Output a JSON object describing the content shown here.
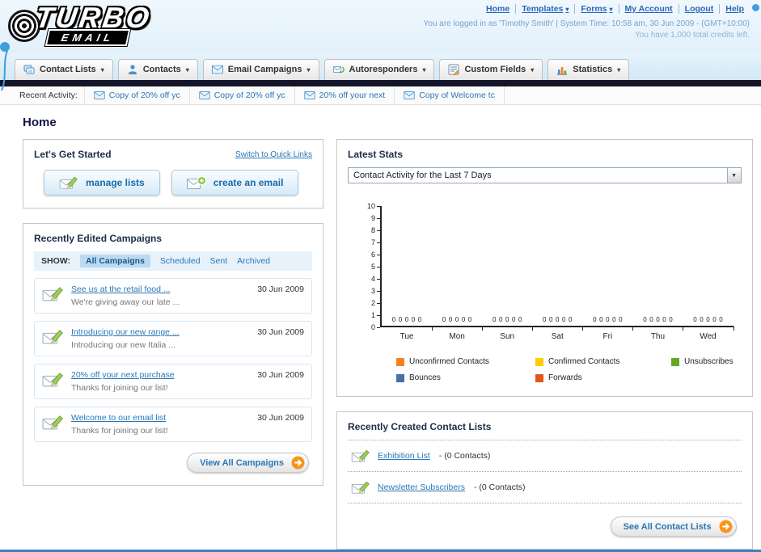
{
  "ui": {
    "caret": "▾",
    "select_arrow": "▼"
  },
  "header": {
    "logo_title": "TURBO",
    "logo_subtitle": "EMAIL",
    "nav": [
      "Home",
      "Templates",
      "Forms",
      "My Account",
      "Logout",
      "Help"
    ],
    "login_status": "You are logged in as 'Timothy Smith' | System Time: 10:58 am, 30 Jun 2009 - (GMT+10:00)",
    "credits": "You have 1,000 total credits left."
  },
  "tabs": [
    {
      "label": "Contact Lists",
      "icon": "contact-lists-icon"
    },
    {
      "label": "Contacts",
      "icon": "contacts-icon"
    },
    {
      "label": "Email Campaigns",
      "icon": "email-campaigns-icon"
    },
    {
      "label": "Autoresponders",
      "icon": "autoresponders-icon"
    },
    {
      "label": "Custom Fields",
      "icon": "custom-fields-icon"
    },
    {
      "label": "Statistics",
      "icon": "statistics-icon"
    }
  ],
  "recent_activity": {
    "label": "Recent Activity:",
    "items": [
      "Copy of 20% off yc",
      "Copy of 20% off yc",
      "20% off your next",
      "Copy of Welcome tc"
    ]
  },
  "page_title": "Home",
  "get_started": {
    "title": "Let's Get Started",
    "switch_link": "Switch to Quick Links",
    "manage_lists_button": "manage lists",
    "create_email_button": "create an email"
  },
  "campaigns": {
    "title": "Recently Edited Campaigns",
    "show_label": "SHOW:",
    "filters": [
      "All Campaigns",
      "Scheduled",
      "Sent",
      "Archived"
    ],
    "selected_filter": "All Campaigns",
    "items": [
      {
        "title": "See us at the retail food ...",
        "subtitle": "We're giving away our late ...",
        "date": "30 Jun 2009"
      },
      {
        "title": "Introducing our new range ...",
        "subtitle": "Introducing our new Italia ...",
        "date": "30 Jun 2009"
      },
      {
        "title": "20% off your next purchase",
        "subtitle": "Thanks for joining our list!",
        "date": "30 Jun 2009"
      },
      {
        "title": "Welcome to our email list",
        "subtitle": "Thanks for joining our list!",
        "date": "30 Jun 2009"
      }
    ],
    "view_all_button": "View All Campaigns"
  },
  "latest_stats": {
    "title": "Latest Stats",
    "period_selector": "Contact Activity for the Last 7 Days",
    "chart_data": {
      "type": "bar",
      "title": "Contact Activity for the Last 7 Days",
      "categories": [
        "Tue",
        "Mon",
        "Sun",
        "Sat",
        "Fri",
        "Thu",
        "Wed"
      ],
      "series": [
        {
          "name": "Unconfirmed Contacts",
          "color": "#f5821f",
          "values": [
            0,
            0,
            0,
            0,
            0,
            0,
            0
          ]
        },
        {
          "name": "Confirmed Contacts",
          "color": "#ffcc00",
          "values": [
            0,
            0,
            0,
            0,
            0,
            0,
            0
          ]
        },
        {
          "name": "Unsubscribes",
          "color": "#61a823",
          "values": [
            0,
            0,
            0,
            0,
            0,
            0,
            0
          ]
        },
        {
          "name": "Bounces",
          "color": "#4a6ea9",
          "values": [
            0,
            0,
            0,
            0,
            0,
            0,
            0
          ]
        },
        {
          "name": "Forwards",
          "color": "#e2571b",
          "values": [
            0,
            0,
            0,
            0,
            0,
            0,
            0
          ]
        }
      ],
      "ylim": [
        0,
        10
      ],
      "ytick_step": 1,
      "grid": false,
      "legend_position": "bottom"
    }
  },
  "contact_lists": {
    "title": "Recently Created Contact Lists",
    "items": [
      {
        "name": "Exhibition List",
        "detail": "- (0 Contacts)"
      },
      {
        "name": "Newsletter Subscribers",
        "detail": "- (0 Contacts)"
      }
    ],
    "see_all_button": "See All Contact Lists"
  },
  "accent_colors": {
    "link_blue": "#2a77b5",
    "orange": "#f7941d",
    "dark_bar": "#15152a"
  }
}
